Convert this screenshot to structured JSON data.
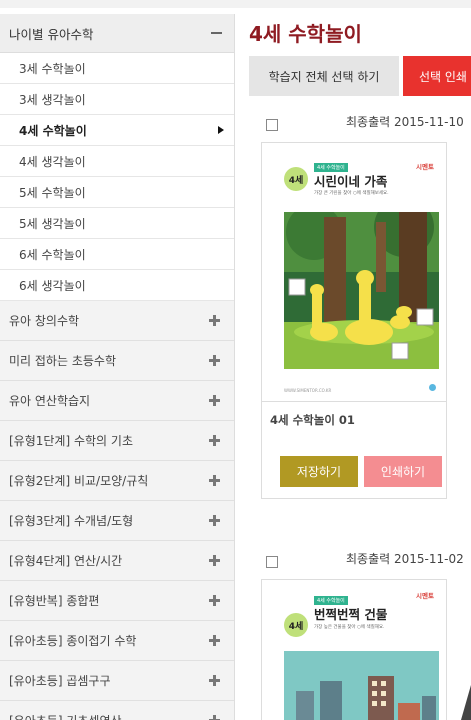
{
  "sidebar": {
    "section_title": "나이별 유아수학",
    "sub_items": [
      {
        "label": "3세 수학놀이",
        "active": false
      },
      {
        "label": "3세 생각놀이",
        "active": false
      },
      {
        "label": "4세 수학놀이",
        "active": true
      },
      {
        "label": "4세 생각놀이",
        "active": false
      },
      {
        "label": "5세 수학놀이",
        "active": false
      },
      {
        "label": "5세 생각놀이",
        "active": false
      },
      {
        "label": "6세 수학놀이",
        "active": false
      },
      {
        "label": "6세 생각놀이",
        "active": false
      }
    ],
    "categories": [
      "유아 창의수학",
      "미리 접하는 초등수학",
      "유아 연산학습지",
      "[유형1단계] 수학의 기초",
      "[유형2단계] 비교/모양/규칙",
      "[유형3단계] 수개념/도형",
      "[유형4단계] 연산/시간",
      "[유형반복] 종합편",
      "[유아초등] 종이접기 수학",
      "[유아초등] 곱셈구구",
      "[유아초등] 기초셈연산"
    ]
  },
  "main": {
    "title": "4세 수학놀이",
    "select_all_label": "학습지 전체 선택 하기",
    "print_selected_label": "선택 인쇄",
    "cards": [
      {
        "date_label": "최종출력 2015-11-10",
        "title": "4세 수학놀이 01",
        "save_label": "저장하기",
        "print_label": "인쇄하기",
        "sheet": {
          "age_badge": "4세",
          "chip": "4세 수학놀이",
          "heading": "시린이네 가족",
          "subtitle": "가장 큰 기린을 찾아 ○에 색칠해보세요.",
          "logo": "시멘토",
          "url": "WWW.SIMENTOR.CO.KR"
        }
      },
      {
        "date_label": "최종출력 2015-11-02",
        "sheet": {
          "age_badge": "4세",
          "chip": "4세 수학놀이",
          "heading": "번쩍번쩍 건물",
          "subtitle": "가장 높은 건물을 찾아 ○에 색칠해요.",
          "logo": "시멘토"
        }
      }
    ]
  },
  "colors": {
    "title": "#8f1b22",
    "print_selected": "#e8322e",
    "save": "#b19923",
    "print": "#f48d91"
  }
}
